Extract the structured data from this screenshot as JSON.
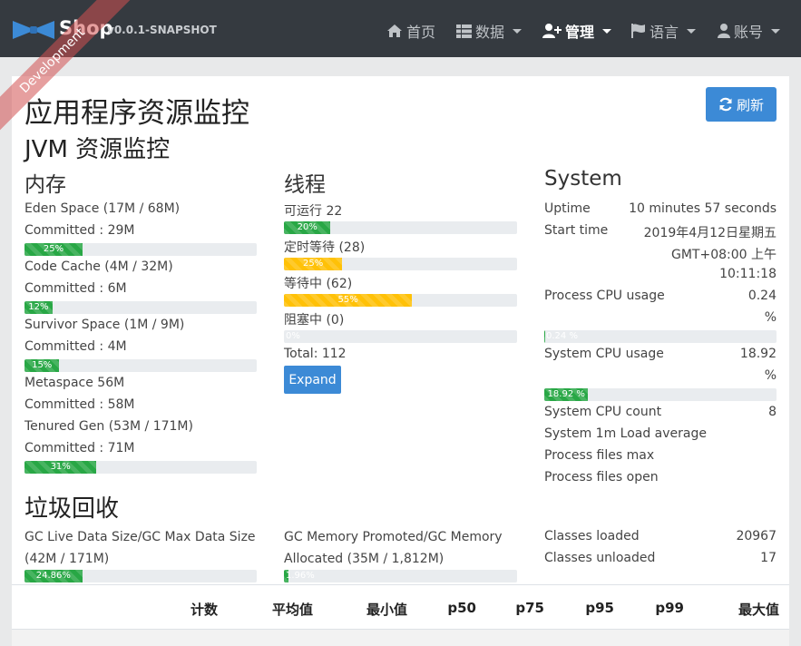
{
  "navbar": {
    "brand_name": "Shop",
    "version": "v0.0.1-SNAPSHOT",
    "items": [
      {
        "label": "首页"
      },
      {
        "label": "数据"
      },
      {
        "label": "管理"
      },
      {
        "label": "语言"
      },
      {
        "label": "账号"
      }
    ]
  },
  "ribbon": "Development",
  "page": {
    "title": "应用程序资源监控",
    "refresh_label": "刷新",
    "subtitle": "JVM 资源监控"
  },
  "memory": {
    "title": "内存",
    "pools": [
      {
        "name": "Eden Space (17M / 68M)",
        "committed": "Committed : 29M",
        "percent": 25,
        "label": "25%"
      },
      {
        "name": "Code Cache (4M / 32M)",
        "committed": "Committed : 6M",
        "percent": 12,
        "label": "12%"
      },
      {
        "name": "Survivor Space (1M / 9M)",
        "committed": "Committed : 4M",
        "percent": 15,
        "label": "15%"
      },
      {
        "name": "Metaspace 56M",
        "committed": "Committed : 58M"
      },
      {
        "name": "Tenured Gen (53M / 171M)",
        "committed": "Committed : 71M",
        "percent": 31,
        "label": "31%"
      }
    ]
  },
  "threads": {
    "title": "线程",
    "rows": [
      {
        "name": "可运行 22",
        "percent": 20,
        "label": "20%",
        "color": "#28a745"
      },
      {
        "name": "定时等待 (28)",
        "percent": 25,
        "label": "25%",
        "color": "#ffc107"
      },
      {
        "name": "等待中 (62)",
        "percent": 55,
        "label": "55%",
        "color": "#ffc107"
      },
      {
        "name": "阻塞中 (0)",
        "percent": 0,
        "label": "0%",
        "color": "#28a745"
      }
    ],
    "total": "Total: 112",
    "expand_label": "Expand"
  },
  "system": {
    "title": "System",
    "uptime_label": "Uptime",
    "uptime_value": "10 minutes 57 seconds",
    "start_label": "Start time",
    "start_value_1": "2019年4月12日星期五",
    "start_value_2": "GMT+08:00 上午",
    "start_value_3": "10:11:18",
    "process_cpu_label": "Process CPU usage",
    "process_cpu_value": "0.24",
    "process_cpu_unit": "%",
    "process_cpu_percent": 0.24,
    "process_cpu_bar_label": "0.24 %",
    "system_cpu_label": "System CPU usage",
    "system_cpu_value": "18.92",
    "system_cpu_unit": "%",
    "system_cpu_percent": 18.92,
    "system_cpu_bar_label": "18.92 %",
    "cpu_count_label": "System CPU count",
    "cpu_count_value": "8",
    "load_label": "System 1m Load average",
    "files_max_label": "Process files max",
    "files_open_label": "Process files open"
  },
  "gc": {
    "title": "垃圾回收",
    "live_text_1": "GC Live Data Size/GC Max Data Size",
    "live_text_2": "(42M / 171M)",
    "live_percent": 24.86,
    "live_label": "24.86%",
    "promoted_text_1": "GC Memory Promoted/GC Memory",
    "promoted_text_2": "Allocated (35M / 1,812M)",
    "promoted_percent": 1.96,
    "promoted_label": "1.96%",
    "classes_loaded_label": "Classes loaded",
    "classes_loaded_value": "20967",
    "classes_unloaded_label": "Classes unloaded",
    "classes_unloaded_value": "17"
  },
  "table": {
    "headers": [
      "计数",
      "平均值",
      "最小值",
      "p50",
      "p75",
      "p95",
      "p99",
      "最大值"
    ]
  },
  "colors": {
    "navbar": "#353a40",
    "primary": "#3c8ad6",
    "success": "#28a745",
    "warning": "#ffc107"
  }
}
